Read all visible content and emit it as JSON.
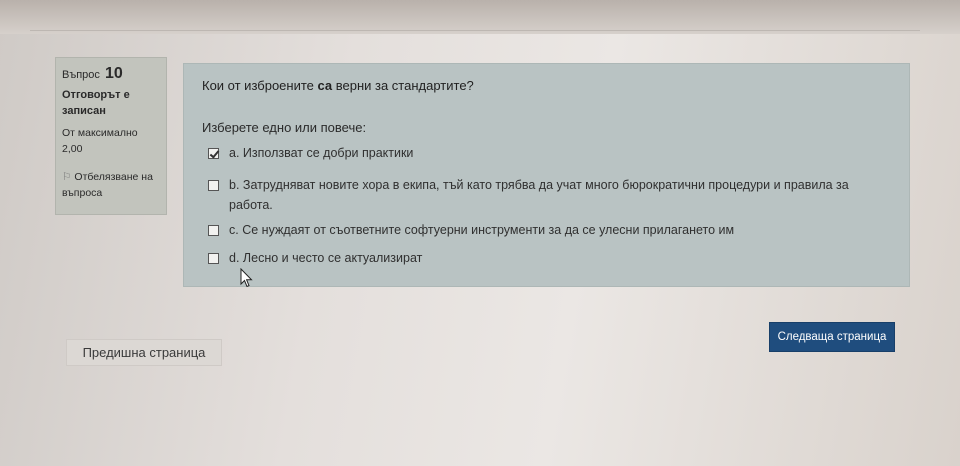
{
  "info": {
    "question_label": "Въпрос",
    "question_number": "10",
    "status": "Отговорът е записан",
    "grade": "От максимално 2,00",
    "flag_label": "Отбелязване на въпроса"
  },
  "question": {
    "text_before": "Кои от изброените ",
    "text_bold": "са",
    "text_after": " верни за стандартите?",
    "prompt": "Изберете едно или повече:",
    "answers": [
      {
        "letter": "a.",
        "text": "Използват се добри практики",
        "checked": true
      },
      {
        "letter": "b.",
        "text": "Затрудняват новите хора в екипа, тъй като трябва да учат много бюрократични процедури и правила за работа.",
        "checked": false
      },
      {
        "letter": "c.",
        "text": "Се нуждаят от съответните софтуерни инструменти за да се улесни прилагането им",
        "checked": false
      },
      {
        "letter": "d.",
        "text": "Лесно и често се актуализират",
        "checked": false
      }
    ]
  },
  "nav": {
    "prev_label": "Предишна страница",
    "next_label": "Следваща страница"
  },
  "colors": {
    "next_button": "#1f4d7e",
    "content_bg": "#b9c3c3",
    "info_bg": "#c2c4bd"
  },
  "icons": {
    "flag": "flag-icon",
    "cursor": "mouse-cursor-icon"
  }
}
